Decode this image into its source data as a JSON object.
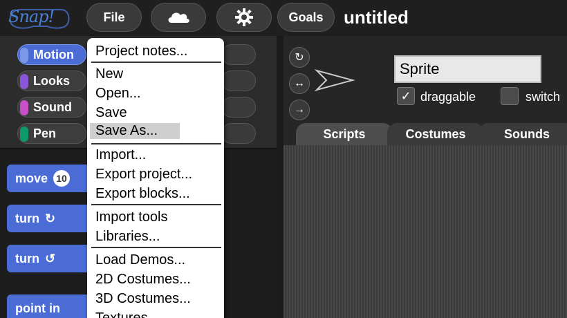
{
  "topbar": {
    "logo_text": "Snap!",
    "file_label": "File",
    "goals_label": "Goals",
    "title": "untitled"
  },
  "categories": [
    {
      "label": "Motion",
      "color": "#4a6cd4"
    },
    {
      "label": "Looks",
      "color": "#8a55d7"
    },
    {
      "label": "Sound",
      "color": "#c94fc9"
    },
    {
      "label": "Pen",
      "color": "#0e9a6c"
    }
  ],
  "palette": {
    "blocks": [
      {
        "label": "move",
        "slot": "10"
      },
      {
        "label": "turn",
        "icon": "↻"
      },
      {
        "label": "turn",
        "icon": "↺"
      },
      {
        "label": "point in",
        "slot": ""
      }
    ]
  },
  "menu": {
    "items": [
      "Project notes...",
      "New",
      "Open...",
      "Save",
      "Save As...",
      "Import...",
      "Export project...",
      "Export blocks...",
      "Import tools",
      "Libraries...",
      "Load Demos...",
      "2D Costumes...",
      "3D Costumes...",
      "Textures..."
    ],
    "highlighted": "Save As..."
  },
  "sprite": {
    "name": "Sprite",
    "draggable_label": "draggable",
    "switch_label": "switch",
    "draggable_checked": "✓"
  },
  "tabs": [
    "Scripts",
    "Costumes",
    "Sounds"
  ]
}
